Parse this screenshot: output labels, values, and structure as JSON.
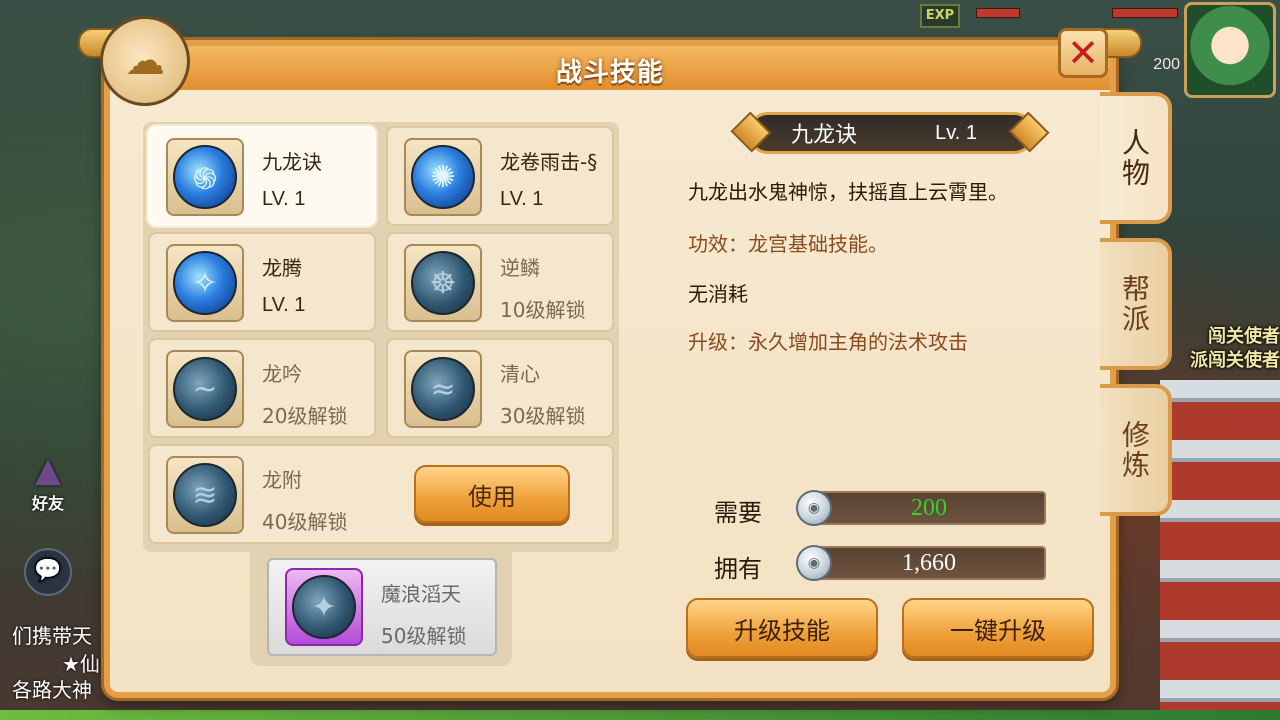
{
  "panel": {
    "title": "战斗技能"
  },
  "side_tabs": [
    {
      "label": "人物"
    },
    {
      "label": "帮派"
    },
    {
      "label": "修炼"
    }
  ],
  "skills": [
    {
      "name": "九龙诀",
      "sub": "LV. 1",
      "glyph": "֍"
    },
    {
      "name": "龙卷雨击-§",
      "sub": "LV. 1",
      "glyph": "✺"
    },
    {
      "name": "龙腾",
      "sub": "LV. 1",
      "glyph": "✧"
    },
    {
      "name": "逆鳞",
      "sub": "10级解锁",
      "glyph": "☸"
    },
    {
      "name": "龙吟",
      "sub": "20级解锁",
      "glyph": "~"
    },
    {
      "name": "清心",
      "sub": "30级解锁",
      "glyph": "≈"
    },
    {
      "name": "龙附",
      "sub": "40级解锁",
      "glyph": "≋"
    }
  ],
  "special_skill": {
    "name": "魔浪滔天",
    "sub": "50级解锁",
    "glyph": "✦"
  },
  "use_button": "使用",
  "detail": {
    "name": "九龙诀",
    "level": "Lv. 1",
    "description": "九龙出水鬼神惊，扶摇直上云霄里。",
    "effect": "功效：龙宫基础技能。",
    "cost_text": "无消耗",
    "upgrade_text": "升级：永久增加主角的法术攻击"
  },
  "cost": {
    "need_label": "需要",
    "need_value": "200",
    "need_color": "#2fd62f",
    "own_label": "拥有",
    "own_value": "1,660"
  },
  "buttons": {
    "upgrade": "升级技能",
    "one_key_upgrade": "一键升级"
  },
  "hud": {
    "exp_label": "EXP",
    "currency_value": "200",
    "friends_label": "好友",
    "npc_line1": "闯关使者",
    "npc_line2": "派闯关使者",
    "chat_line1": "们携带天",
    "chat_line2": "★仙",
    "chat_line3": "各路大神"
  }
}
